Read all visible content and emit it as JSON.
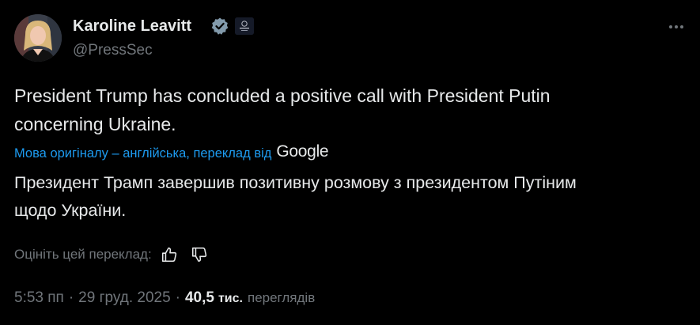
{
  "author": {
    "name": "Karoline Leavitt",
    "handle": "@PressSec",
    "verified_color": "#829aab",
    "avatar_icon": "portrait-avatar",
    "affiliation_icon": "white-house-seal-icon"
  },
  "menu": {
    "icon": "more-horizontal-icon"
  },
  "tweet": {
    "text_line1": "President Trump has concluded a positive call with President Putin",
    "text_line2": "concerning Ukraine."
  },
  "translation": {
    "note": "Мова оригіналу – англійська, переклад від",
    "provider": "Google",
    "text_line1": "Президент Трамп завершив позитивну розмову з президентом Путіним",
    "text_line2": "щодо України."
  },
  "rating": {
    "label": "Оцініть цей переклад:",
    "up_icon": "thumbs-up-icon",
    "down_icon": "thumbs-down-icon"
  },
  "meta": {
    "time": "5:53 пп",
    "separator": "·",
    "date": "29 груд. 2025",
    "views_count": "40,5",
    "views_unit": "тис.",
    "views_label": "переглядів"
  },
  "colors": {
    "background": "#000000",
    "text": "#e7e9ea",
    "secondary": "#71767b",
    "link": "#1d9bf0"
  }
}
